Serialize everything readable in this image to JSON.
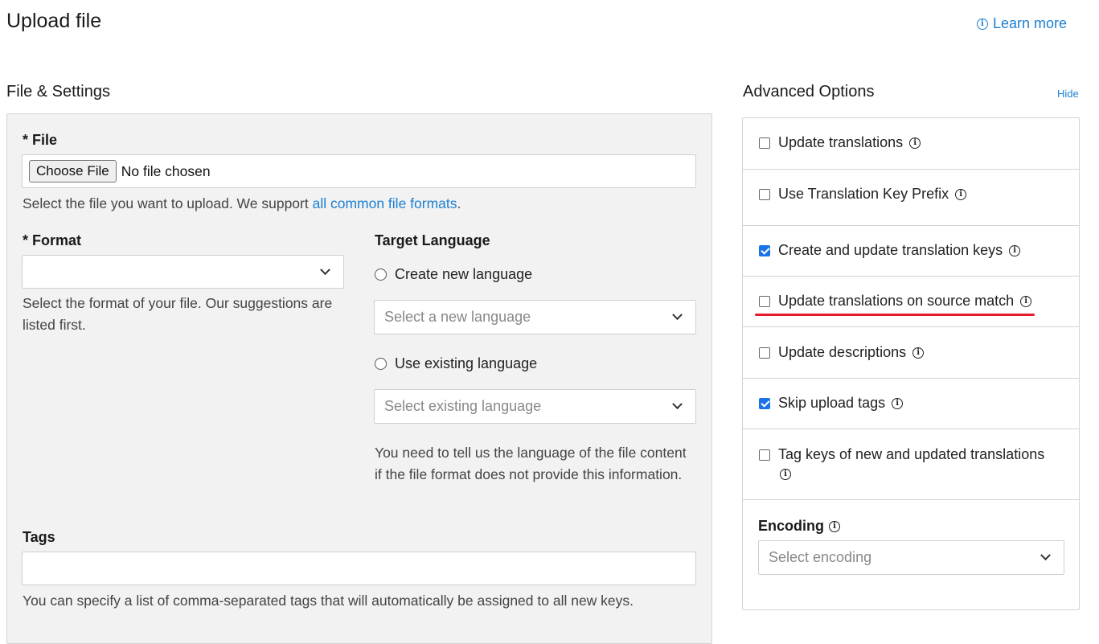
{
  "header": {
    "title": "Upload file",
    "learn_more": "Learn more"
  },
  "file_settings": {
    "title": "File & Settings",
    "file_label": "* File",
    "choose_file_button": "Choose File",
    "no_file_text": "No file chosen",
    "file_help_prefix": "Select the file you want to upload. We support ",
    "file_help_link": "all common file formats",
    "file_help_suffix": ".",
    "format_label": "* Format",
    "format_value": "",
    "format_help": "Select the format of your file. Our suggestions are listed first.",
    "target_language_label": "Target Language",
    "create_new_language": "Create new language",
    "select_new_language_placeholder": "Select a new language",
    "use_existing_language": "Use existing language",
    "select_existing_language_placeholder": "Select existing language",
    "language_help": "You need to tell us the language of the file content if the file format does not provide this information.",
    "tags_label": "Tags",
    "tags_value": "",
    "tags_help": "You can specify a list of comma-separated tags that will automatically be assigned to all new keys."
  },
  "advanced": {
    "title": "Advanced Options",
    "hide_link": "Hide",
    "options": [
      {
        "label": "Update translations",
        "checked": false
      },
      {
        "label": "Use Translation Key Prefix",
        "checked": false
      },
      {
        "label": "Create and update translation keys",
        "checked": true
      },
      {
        "label": "Update translations on source match",
        "checked": false
      },
      {
        "label": "Update descriptions",
        "checked": false
      },
      {
        "label": "Skip upload tags",
        "checked": true
      },
      {
        "label": "Tag keys of new and updated translations",
        "checked": false
      }
    ],
    "encoding_label": "Encoding",
    "encoding_placeholder": "Select encoding"
  },
  "colors": {
    "link": "#1b7fd1",
    "checkbox_checked": "#1a73e8",
    "annotation_underline": "#e8192c"
  },
  "icons": [
    "info-icon",
    "chevron-down-icon",
    "checkbox-icon",
    "radio-icon"
  ]
}
